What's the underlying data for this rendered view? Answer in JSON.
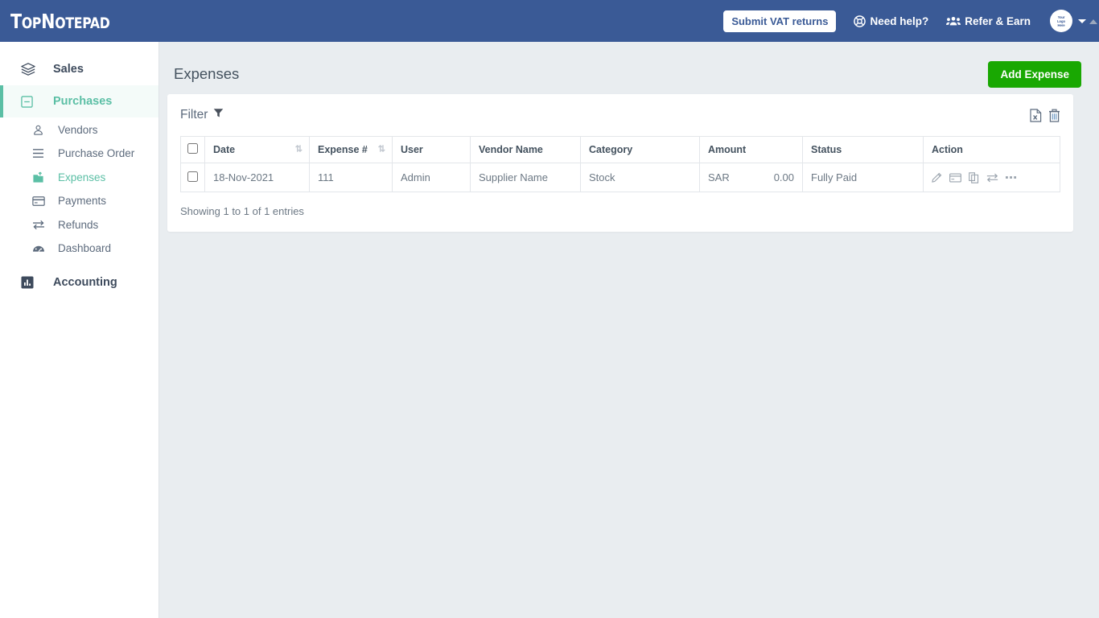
{
  "navbar": {
    "logo_primary": "T",
    "logo_text_1": "op",
    "logo_text_2": "N",
    "logo_text_3": "otepad",
    "logo_full": "TopNotepad",
    "vat_button": "Submit VAT returns",
    "need_help": "Need help?",
    "refer_earn": "Refer & Earn",
    "avatar_line1": "Your",
    "avatar_line2": "Logo",
    "avatar_line3": "Here",
    "bg_color": "#3a5a96"
  },
  "sidebar": {
    "groups": [
      {
        "label": "Sales",
        "icon": "layers-icon",
        "active": false
      },
      {
        "label": "Purchases",
        "icon": "minus-square-icon",
        "active": true
      }
    ],
    "items": [
      {
        "label": "Vendors",
        "icon": "user-circle-icon",
        "selected": false
      },
      {
        "label": "Purchase Order",
        "icon": "list-icon",
        "selected": false
      },
      {
        "label": "Expenses",
        "icon": "expense-icon",
        "selected": true
      },
      {
        "label": "Payments",
        "icon": "credit-card-icon",
        "selected": false
      },
      {
        "label": "Refunds",
        "icon": "exchange-icon",
        "selected": false
      },
      {
        "label": "Dashboard",
        "icon": "dashboard-icon",
        "selected": false
      }
    ],
    "group_bottom": {
      "label": "Accounting",
      "icon": "bar-chart-icon"
    },
    "accent_color": "#5bbfa5"
  },
  "page": {
    "title": "Expenses",
    "add_button": "Add Expense",
    "add_button_color": "#19a802",
    "background": "#e9edf0"
  },
  "card": {
    "filter_label": "Filter",
    "filter_icon": "funnel-icon",
    "export_icon": "export-excel-icon",
    "delete_icon": "trash-icon"
  },
  "table": {
    "columns": [
      {
        "label": "",
        "key": "checkbox",
        "sortable": false
      },
      {
        "label": "Date",
        "key": "date",
        "sortable": true
      },
      {
        "label": "Expense #",
        "key": "expense_no",
        "sortable": true
      },
      {
        "label": "User",
        "key": "user",
        "sortable": false
      },
      {
        "label": "Vendor Name",
        "key": "vendor",
        "sortable": false
      },
      {
        "label": "Category",
        "key": "category",
        "sortable": false
      },
      {
        "label": "Amount",
        "key": "amount",
        "sortable": false
      },
      {
        "label": "Status",
        "key": "status",
        "sortable": false
      },
      {
        "label": "Action",
        "key": "action",
        "sortable": false
      }
    ],
    "rows": [
      {
        "date": "18-Nov-2021",
        "expense_no": "111",
        "user": "Admin",
        "vendor": "Supplier Name",
        "category": "Stock",
        "currency": "SAR",
        "amount": "0.00",
        "status": "Fully Paid",
        "actions": [
          "edit-icon",
          "payment-card-icon",
          "duplicate-icon",
          "refund-icon",
          "more-icon"
        ]
      }
    ],
    "footer": "Showing 1 to 1 of 1 entries"
  }
}
